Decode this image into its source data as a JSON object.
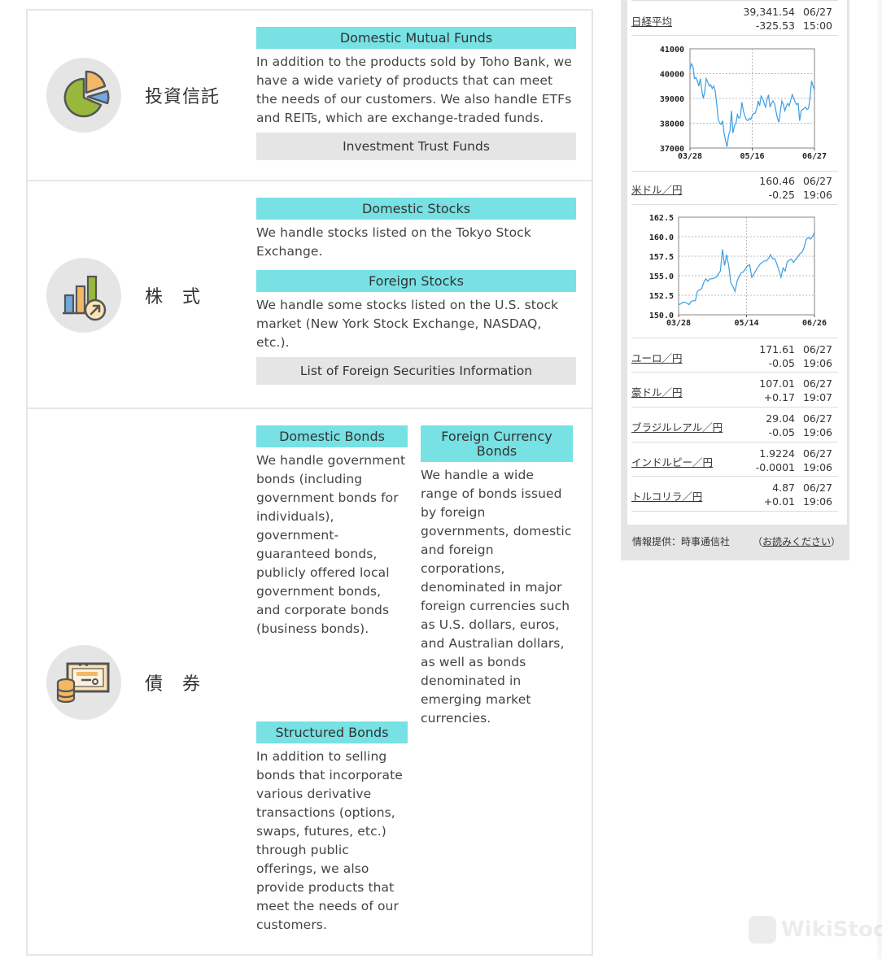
{
  "products": [
    {
      "category": "投資信託",
      "icon": "pie-chart-icon",
      "sections": [
        {
          "header": "Domestic Mutual Funds",
          "description": "In addition to the products sold by Toho Bank, we have a wide variety of products that can meet the needs of our customers. We also handle ETFs and REITs, which are exchange-traded funds.",
          "button": "Investment Trust Funds"
        }
      ]
    },
    {
      "category": "株　式",
      "icon": "bar-chart-growth-icon",
      "sections": [
        {
          "header": "Domestic Stocks",
          "description": "We handle stocks listed on the Tokyo Stock Exchange."
        },
        {
          "header": "Foreign Stocks",
          "description": "We handle some stocks listed on the U.S. stock market (New York Stock Exchange, NASDAQ, etc.).",
          "button": "List of Foreign Securities Information"
        }
      ]
    },
    {
      "category": "債　券",
      "icon": "bond-certificate-icon",
      "sections": [
        {
          "header": "Domestic Bonds",
          "description": "We handle government bonds (including government bonds for individuals), government-guaranteed bonds, publicly offered local government bonds, and corporate bonds (business bonds)."
        },
        {
          "header": "Foreign Currency Bonds",
          "description": "We handle a wide range of bonds issued by foreign governments, domestic and foreign corporations, denominated in major foreign currencies such as U.S. dollars, euros, and Australian dollars, as well as bonds denominated in emerging market currencies."
        },
        {
          "header": "Structured Bonds",
          "description": "In addition to selling bonds that incorporate various derivative transactions (options, swaps, futures, etc.) through public offerings, we also provide products that meet the needs of our customers."
        }
      ]
    }
  ],
  "market": {
    "quotes": [
      {
        "name": "日経平均",
        "value": "39,341.54",
        "change": "-325.53",
        "date": "06/27",
        "time": "15:00"
      },
      {
        "name": "米ドル／円",
        "value": "160.46",
        "change": "-0.25",
        "date": "06/27",
        "time": "19:06"
      },
      {
        "name": "ユーロ／円",
        "value": "171.61",
        "change": "-0.05",
        "date": "06/27",
        "time": "19:06"
      },
      {
        "name": "豪ドル／円",
        "value": "107.01",
        "change": "+0.17",
        "date": "06/27",
        "time": "19:07"
      },
      {
        "name": "ブラジルレアル／円",
        "value": "29.04",
        "change": "-0.05",
        "date": "06/27",
        "time": "19:06"
      },
      {
        "name": "インドルピー／円",
        "value": "1.9224",
        "change": "-0.0001",
        "date": "06/27",
        "time": "19:06"
      },
      {
        "name": "トルコリラ／円",
        "value": "4.87",
        "change": "+0.01",
        "date": "06/27",
        "time": "19:06"
      }
    ],
    "source_label": "情報提供：時事通信社",
    "notice_open": "（",
    "notice_link": "お読みください",
    "notice_close": "）"
  },
  "chart_data": [
    {
      "type": "line",
      "title": "日経平均",
      "x_ticks": [
        "03/28",
        "05/16",
        "06/27"
      ],
      "y_ticks": [
        37000,
        38000,
        39000,
        40000,
        41000
      ],
      "ylim": [
        37000,
        41000
      ],
      "grid": true,
      "color": "#3a9ee4",
      "values": [
        40170,
        40400,
        40300,
        39800,
        39850,
        39700,
        39500,
        39800,
        39300,
        39000,
        39300,
        39800,
        39650,
        39500,
        39550,
        39400,
        39500,
        39300,
        38800,
        38200,
        38000,
        37950,
        38100,
        37600,
        37300,
        37050,
        37500,
        37700,
        38500,
        37600,
        37900,
        38000,
        38350,
        38200,
        38250,
        38850,
        38500,
        38300,
        38150,
        38100,
        38200,
        38150,
        38300,
        38400,
        38400,
        38600,
        38900,
        38700,
        39100,
        39000,
        38800,
        38650,
        38950,
        39150,
        38650,
        38800,
        38900,
        38800,
        38500,
        38200,
        38050,
        38500,
        38900,
        38750,
        38500,
        38700,
        38800,
        38700,
        38950,
        39150,
        39000,
        38850,
        38750,
        38800,
        38100,
        38500,
        38550,
        38600,
        38650,
        38550,
        38600,
        39000,
        39700,
        39500,
        39350
      ]
    },
    {
      "type": "line",
      "title": "米ドル／円",
      "x_ticks": [
        "03/28",
        "05/14",
        "06/26"
      ],
      "y_ticks": [
        150.0,
        152.5,
        155.0,
        157.5,
        160.0,
        162.5
      ],
      "ylim": [
        150.0,
        162.5
      ],
      "grid": true,
      "color": "#3a9ee4",
      "values": [
        151.3,
        151.4,
        151.6,
        151.6,
        151.5,
        151.3,
        151.7,
        151.8,
        151.8,
        153.0,
        153.2,
        153.3,
        154.1,
        154.6,
        154.3,
        154.6,
        154.6,
        154.7,
        154.8,
        155.2,
        155.6,
        158.4,
        156.3,
        157.7,
        156.2,
        154.1,
        153.6,
        153.0,
        154.3,
        154.9,
        155.4,
        155.5,
        155.9,
        156.3,
        156.4,
        154.8,
        155.2,
        155.7,
        156.1,
        156.5,
        156.7,
        156.9,
        156.9,
        157.2,
        157.7,
        157.2,
        157.2,
        156.5,
        155.7,
        154.8,
        156.0,
        155.6,
        156.8,
        157.0,
        157.1,
        156.7,
        157.1,
        157.4,
        157.8,
        158.0,
        158.6,
        159.6,
        159.9,
        159.7,
        160.0,
        160.5
      ]
    }
  ],
  "watermark": "WikiStock"
}
